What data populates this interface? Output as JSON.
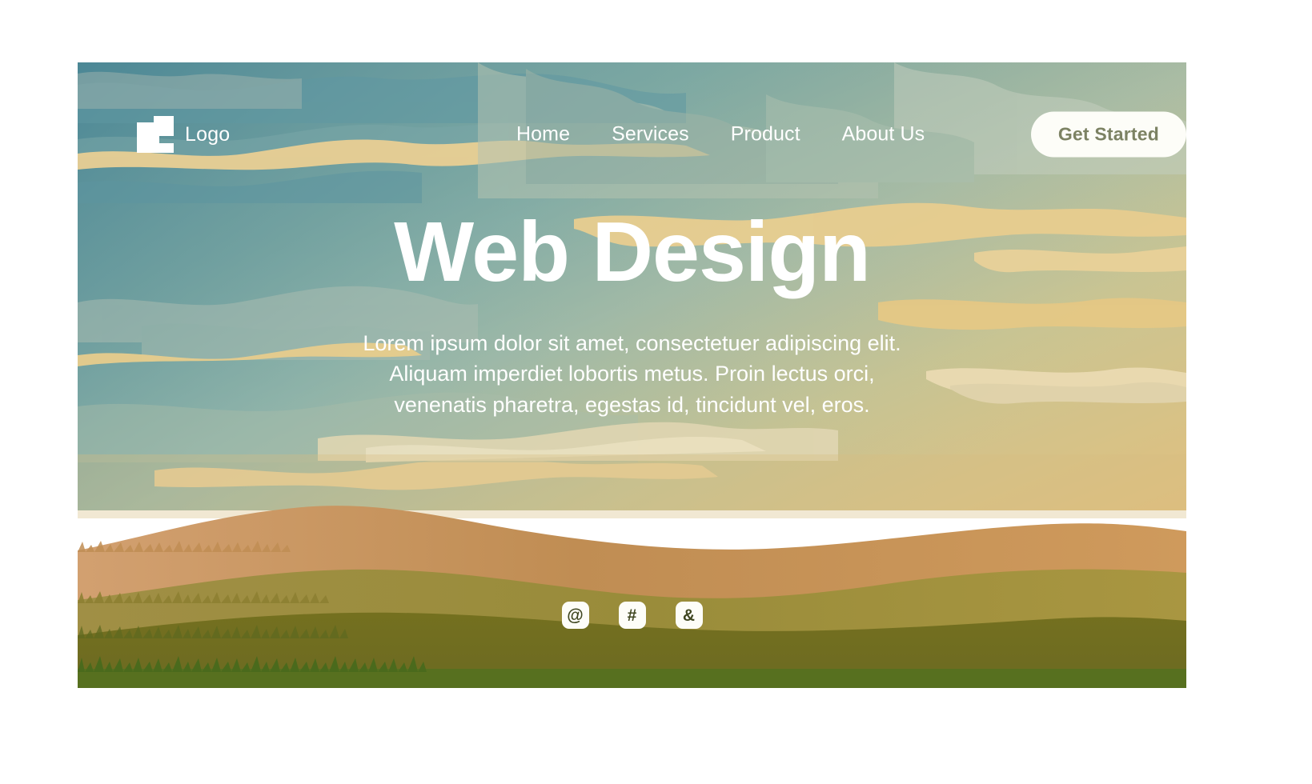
{
  "hero": {
    "title": "Web Design",
    "paragraph_lines": [
      "Lorem ipsum dolor sit amet, consectetuer adipiscing elit.",
      "Aliquam imperdiet lobortis metus. Proin lectus orci,",
      "venenatis pharetra, egestas id, tincidunt vel, eros."
    ],
    "paragraph": "Lorem ipsum dolor sit amet, consectetuer adipiscing elit. Aliquam imperdiet lobortis metus. Proin lectus orci, venenatis pharetra, egestas id, tincidunt vel, eros."
  },
  "navbar": {
    "brand": {
      "label": "Logo",
      "icon": "logo-mark-icon"
    },
    "links": [
      {
        "label": "Home"
      },
      {
        "label": "Services"
      },
      {
        "label": "Product"
      },
      {
        "label": "About Us"
      }
    ],
    "cta": {
      "label": "Get Started"
    }
  },
  "socials": [
    {
      "glyph": "@",
      "icon": "at-sign-icon"
    },
    {
      "glyph": "#",
      "icon": "hash-icon"
    },
    {
      "glyph": "&",
      "icon": "ampersand-icon"
    }
  ],
  "colors": {
    "page_background": "#ffffff",
    "sky_top_left": "#4f8b99",
    "sky_mid": "#9fbfb0",
    "sky_warm": "#d9bd7f",
    "cloud_cream": "#e7cf95",
    "cloud_pale": "#c9d2bd",
    "hill_tan": "#d79a62",
    "field_olive": "#a3913f",
    "field_dark_olive": "#6f6c22",
    "grass_green": "#4e6b22",
    "text_white": "#ffffff",
    "cta_background": "#fdfdf8",
    "cta_text": "#7c8263",
    "social_icon_text": "#3f4620"
  }
}
